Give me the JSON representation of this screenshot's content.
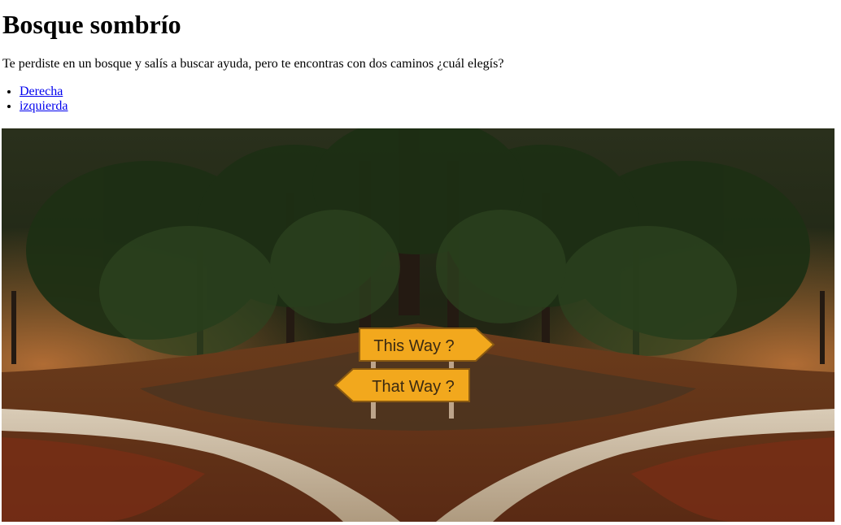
{
  "page": {
    "title": "Bosque sombrío",
    "intro": "Te perdiste en un bosque y salís a buscar ayuda, pero te encontras con dos caminos ¿cuál elegís?",
    "choices": [
      {
        "label": "Derecha"
      },
      {
        "label": "izquierda"
      }
    ]
  },
  "image": {
    "sign_top": "This Way ?",
    "sign_bottom": "That Way ?"
  },
  "colors": {
    "link": "#0000ee",
    "sign": "#f2a81d"
  }
}
